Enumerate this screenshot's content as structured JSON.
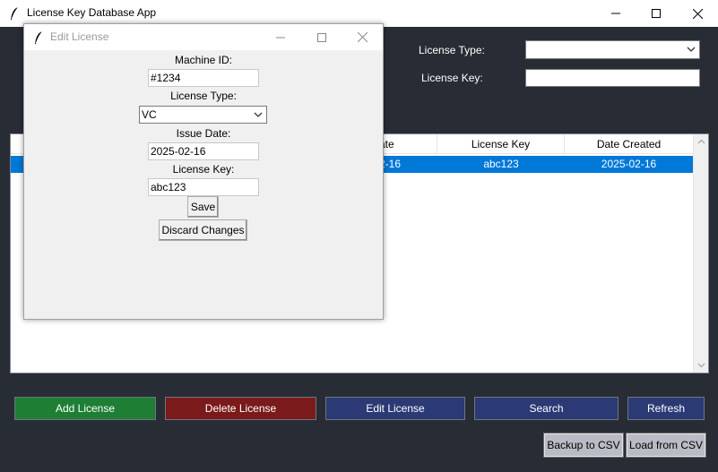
{
  "main_window": {
    "title": "License Key Database App",
    "controls": {
      "minimize": "—",
      "maximize": "☐",
      "close": "✕"
    }
  },
  "filters": {
    "license_type_label": "License Type:",
    "license_type_value": "",
    "license_key_label": "License Key:",
    "license_key_value": ""
  },
  "table": {
    "visible_columns": [
      {
        "label": "ate"
      },
      {
        "label": "License Key"
      },
      {
        "label": "Date Created"
      }
    ],
    "selected_row": {
      "cells": [
        "2-16",
        "abc123",
        "2025-02-16"
      ]
    }
  },
  "buttons": {
    "add": "Add License",
    "delete": "Delete License",
    "edit": "Edit License",
    "search": "Search",
    "refresh": "Refresh",
    "backup": "Backup to CSV",
    "load": "Load from CSV"
  },
  "colors": {
    "add": "#1e7e34",
    "delete": "#7b1a1a",
    "edit": "#2b3a75",
    "search": "#2b3a75",
    "refresh": "#2b3a75",
    "selection": "#0078d7",
    "background": "#282c34"
  },
  "dialog": {
    "title": "Edit License",
    "machine_id_label": "Machine ID:",
    "machine_id_value": "#1234",
    "license_type_label": "License Type:",
    "license_type_value": "VC",
    "issue_date_label": "Issue Date:",
    "issue_date_value": "2025-02-16",
    "license_key_label": "License Key:",
    "license_key_value": "abc123",
    "save": "Save",
    "discard": "Discard Changes"
  },
  "icons": {
    "app": "feather-icon",
    "combo": "chevron-down-icon",
    "scroll_up": "scroll-up-arrow-icon",
    "scroll_down": "scroll-down-arrow-icon"
  }
}
